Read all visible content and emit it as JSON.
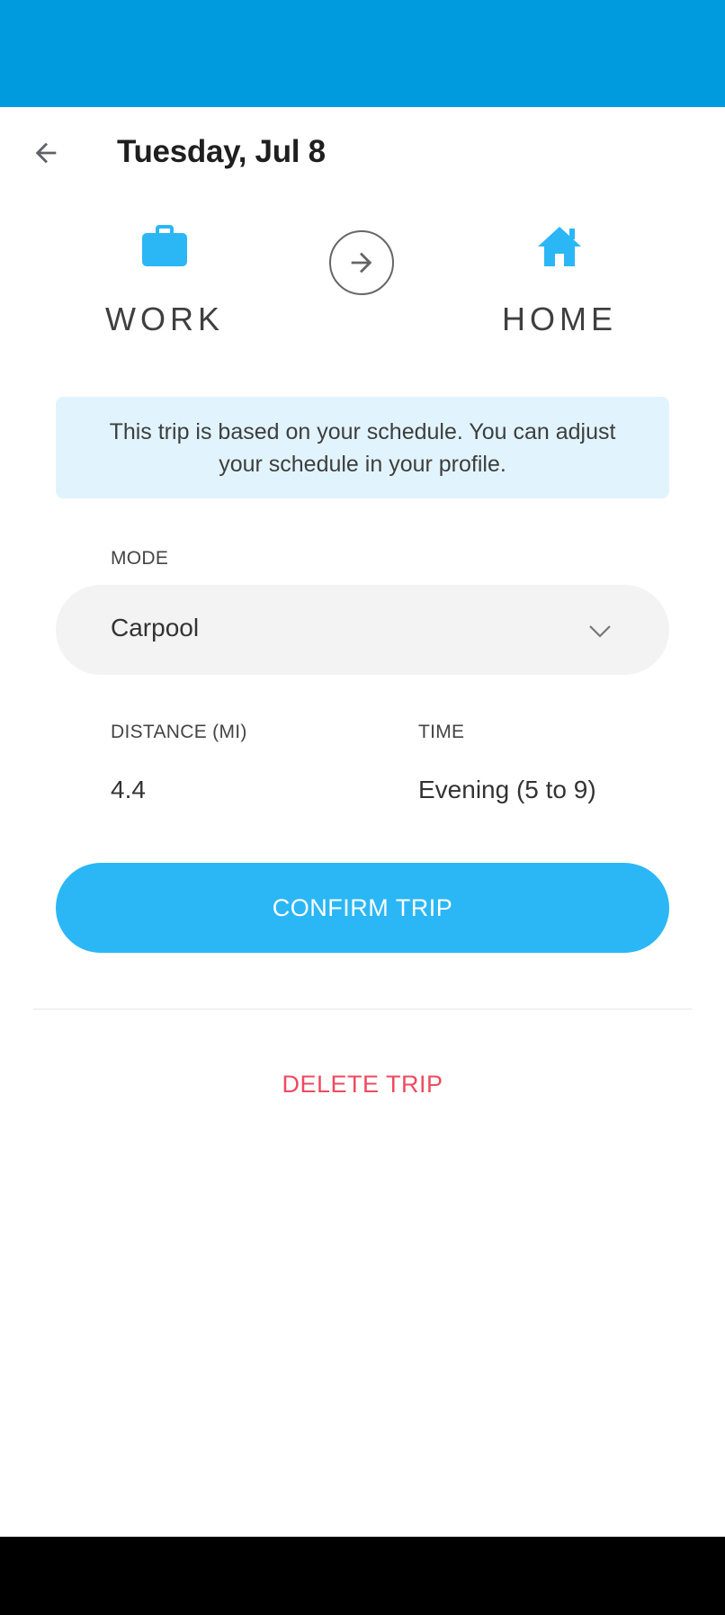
{
  "header": {
    "title": "Tuesday, Jul 8",
    "back_icon": "arrow-left-icon"
  },
  "route": {
    "origin": {
      "label": "WORK",
      "icon": "briefcase-icon"
    },
    "destination": {
      "label": "HOME",
      "icon": "home-icon"
    },
    "arrow_icon": "arrow-right-icon"
  },
  "info": {
    "message": "This trip is based on your schedule. You can adjust your schedule in your profile."
  },
  "mode": {
    "label": "MODE",
    "value": "Carpool"
  },
  "distance": {
    "label": "DISTANCE (MI)",
    "value": "4.4"
  },
  "time": {
    "label": "TIME",
    "value": "Evening (5 to 9)"
  },
  "actions": {
    "confirm_label": "CONFIRM TRIP",
    "delete_label": "DELETE TRIP"
  },
  "colors": {
    "status_bar": "#009BDF",
    "accent": "#2BB7F6",
    "info_bg": "#E1F4FD",
    "danger": "#EF4A60"
  }
}
